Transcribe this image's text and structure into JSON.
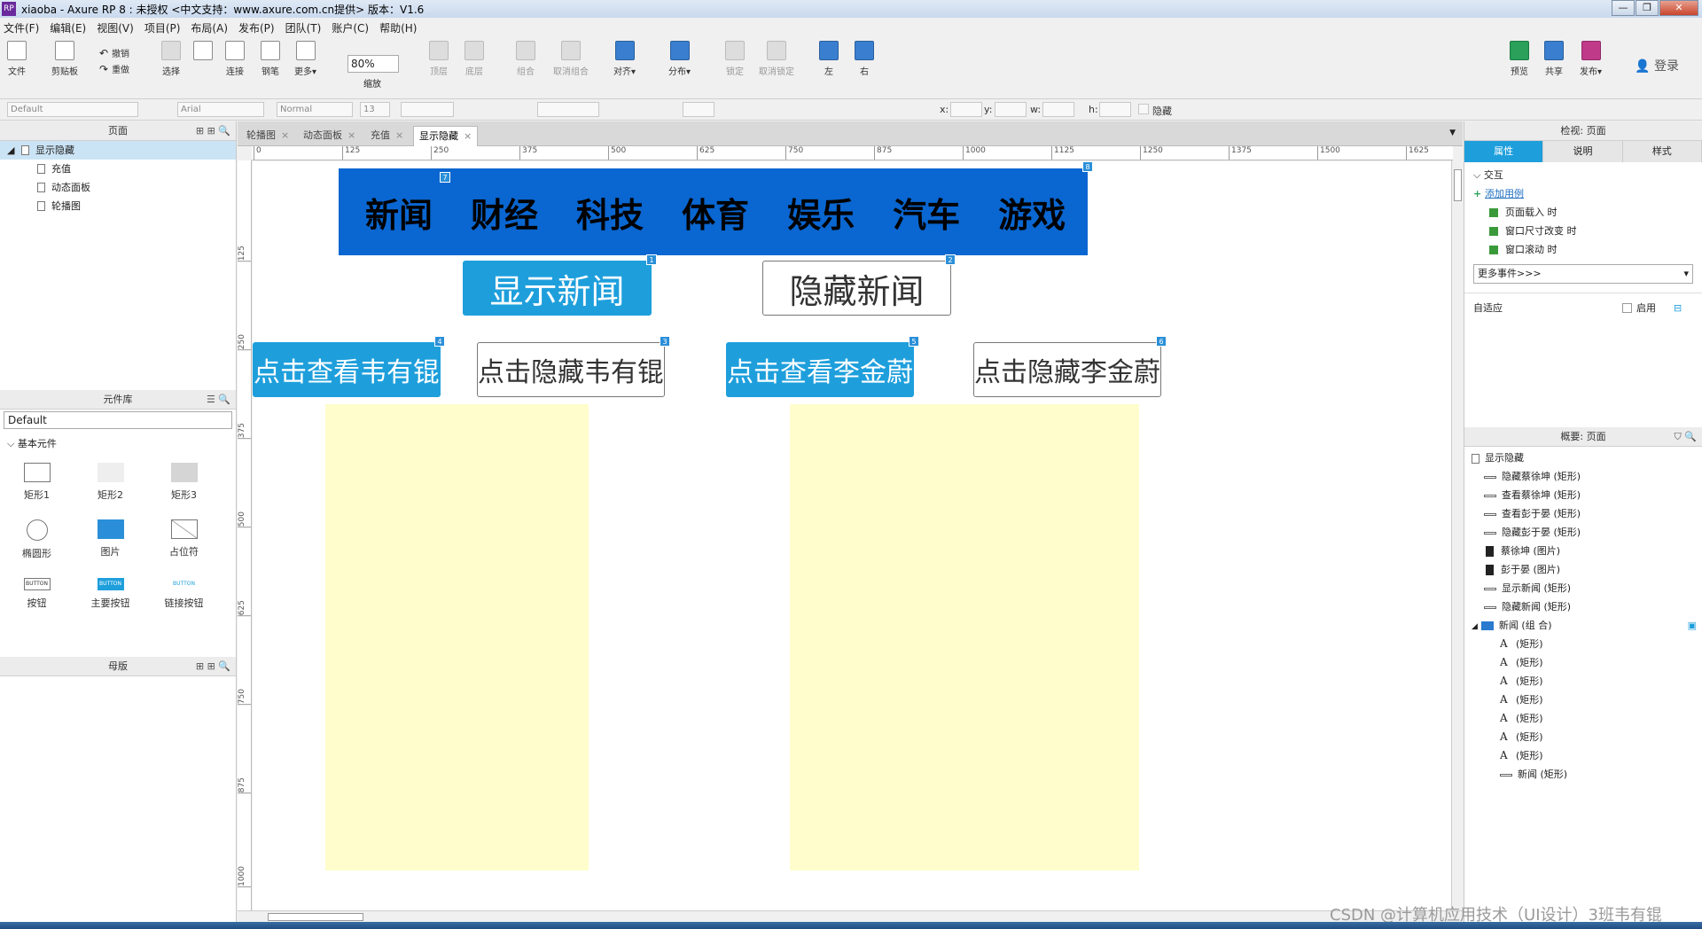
{
  "window": {
    "app_icon": "RP",
    "title": "xiaoba - Axure RP 8 : 未授权      <中文支持：www.axure.com.cn提供> 版本：V1.6",
    "controls": [
      "—",
      "❐",
      "✕"
    ]
  },
  "menu": [
    "文件(F)",
    "编辑(E)",
    "视图(V)",
    "项目(P)",
    "布局(A)",
    "发布(P)",
    "团队(T)",
    "账户(C)",
    "帮助(H)"
  ],
  "toolbar": {
    "file": "文件",
    "clipboard": "剪贴板",
    "undo": "撤销",
    "redo": "重做",
    "select": "选择",
    "connect": "连接",
    "pen": "钢笔",
    "more": "更多▾",
    "zoom_value": "80%",
    "zoom_label": "缩放",
    "top": "顶层",
    "bottom": "底层",
    "group": "组合",
    "ungroup": "取消组合",
    "align": "对齐▾",
    "distribute": "分布▾",
    "lock": "锁定",
    "unlock": "取消锁定",
    "left": "左",
    "right": "右",
    "preview": "预览",
    "share": "共享",
    "publish": "发布▾",
    "login": "登录"
  },
  "formatbar": {
    "style": "Default",
    "font": "Arial",
    "weight": "Normal",
    "size": "13",
    "x_label": "x:",
    "y_label": "y:",
    "w_label": "w:",
    "h_label": "h:",
    "hidden_label": "隐藏"
  },
  "pages_panel": {
    "title": "页面",
    "items": [
      {
        "label": "显示隐藏",
        "selected": true,
        "level": 0
      },
      {
        "label": "充值",
        "selected": false,
        "level": 1
      },
      {
        "label": "动态面板",
        "selected": false,
        "level": 1
      },
      {
        "label": "轮播图",
        "selected": false,
        "level": 1
      }
    ]
  },
  "library_panel": {
    "title": "元件库",
    "selected_library": "Default",
    "section": "基本元件",
    "widgets": [
      "矩形1",
      "矩形2",
      "矩形3",
      "椭圆形",
      "图片",
      "占位符",
      "按钮",
      "主要按钮",
      "链接按钮"
    ],
    "button_text": "BUTTON"
  },
  "masters_panel": {
    "title": "母版"
  },
  "tabs": [
    {
      "label": "轮播图",
      "active": false
    },
    {
      "label": "动态面板",
      "active": false
    },
    {
      "label": "充值",
      "active": false
    },
    {
      "label": "显示隐藏",
      "active": true
    }
  ],
  "ruler": {
    "top": [
      "0",
      "125",
      "250",
      "375",
      "500",
      "625",
      "750",
      "875",
      "1000",
      "1125",
      "1250",
      "1375",
      "1500",
      "1625"
    ],
    "left": [
      "125",
      "250",
      "375",
      "500",
      "625",
      "750",
      "875",
      "1000"
    ]
  },
  "canvas": {
    "nav_items": [
      "新闻",
      "财经",
      "科技",
      "体育",
      "娱乐",
      "汽车",
      "游戏"
    ],
    "show_news": "显示新闻",
    "hide_news": "隐藏新闻",
    "show_wei": "点击查看韦有锟",
    "hide_wei": "点击隐藏韦有锟",
    "show_li": "点击查看李金蔚",
    "hide_li": "点击隐藏李金蔚",
    "markers": [
      "7",
      "8",
      "1",
      "2",
      "4",
      "3",
      "5",
      "6"
    ],
    "panel_color": "#fffdcc",
    "nav_color": "#0a66d0",
    "primary_color": "#1e9fdc"
  },
  "inspector": {
    "title": "检视: 页面",
    "tabs": [
      "属性",
      "说明",
      "样式"
    ],
    "section": "交互",
    "add_case": "添加用例",
    "events": [
      "页面载入 时",
      "窗口尺寸改变 时",
      "窗口滚动 时"
    ],
    "more_events": "更多事件>>>",
    "adaptive": "自适应",
    "enable": "启用"
  },
  "outline": {
    "title": "概要: 页面",
    "page": "显示隐藏",
    "items": [
      {
        "label": "隐藏蔡徐坤 (矩形)",
        "icon": "rect"
      },
      {
        "label": "查看蔡徐坤 (矩形)",
        "icon": "rect"
      },
      {
        "label": "查看彭于晏 (矩形)",
        "icon": "rect"
      },
      {
        "label": "隐藏彭于晏 (矩形)",
        "icon": "rect"
      },
      {
        "label": "蔡徐坤 (图片)",
        "icon": "image"
      },
      {
        "label": "彭于晏 (图片)",
        "icon": "image"
      },
      {
        "label": "显示新闻 (矩形)",
        "icon": "rect"
      },
      {
        "label": "隐藏新闻 (矩形)",
        "icon": "rect"
      },
      {
        "label": "新闻 (组 合)",
        "icon": "folder"
      },
      {
        "label": "(矩形)",
        "icon": "text"
      },
      {
        "label": "(矩形)",
        "icon": "text"
      },
      {
        "label": "(矩形)",
        "icon": "text"
      },
      {
        "label": "(矩形)",
        "icon": "text"
      },
      {
        "label": "(矩形)",
        "icon": "text"
      },
      {
        "label": "(矩形)",
        "icon": "text"
      },
      {
        "label": "(矩形)",
        "icon": "text"
      },
      {
        "label": "新闻 (矩形)",
        "icon": "rect"
      }
    ]
  },
  "watermark": "CSDN @计算机应用技术（UI设计）3班韦有锟"
}
